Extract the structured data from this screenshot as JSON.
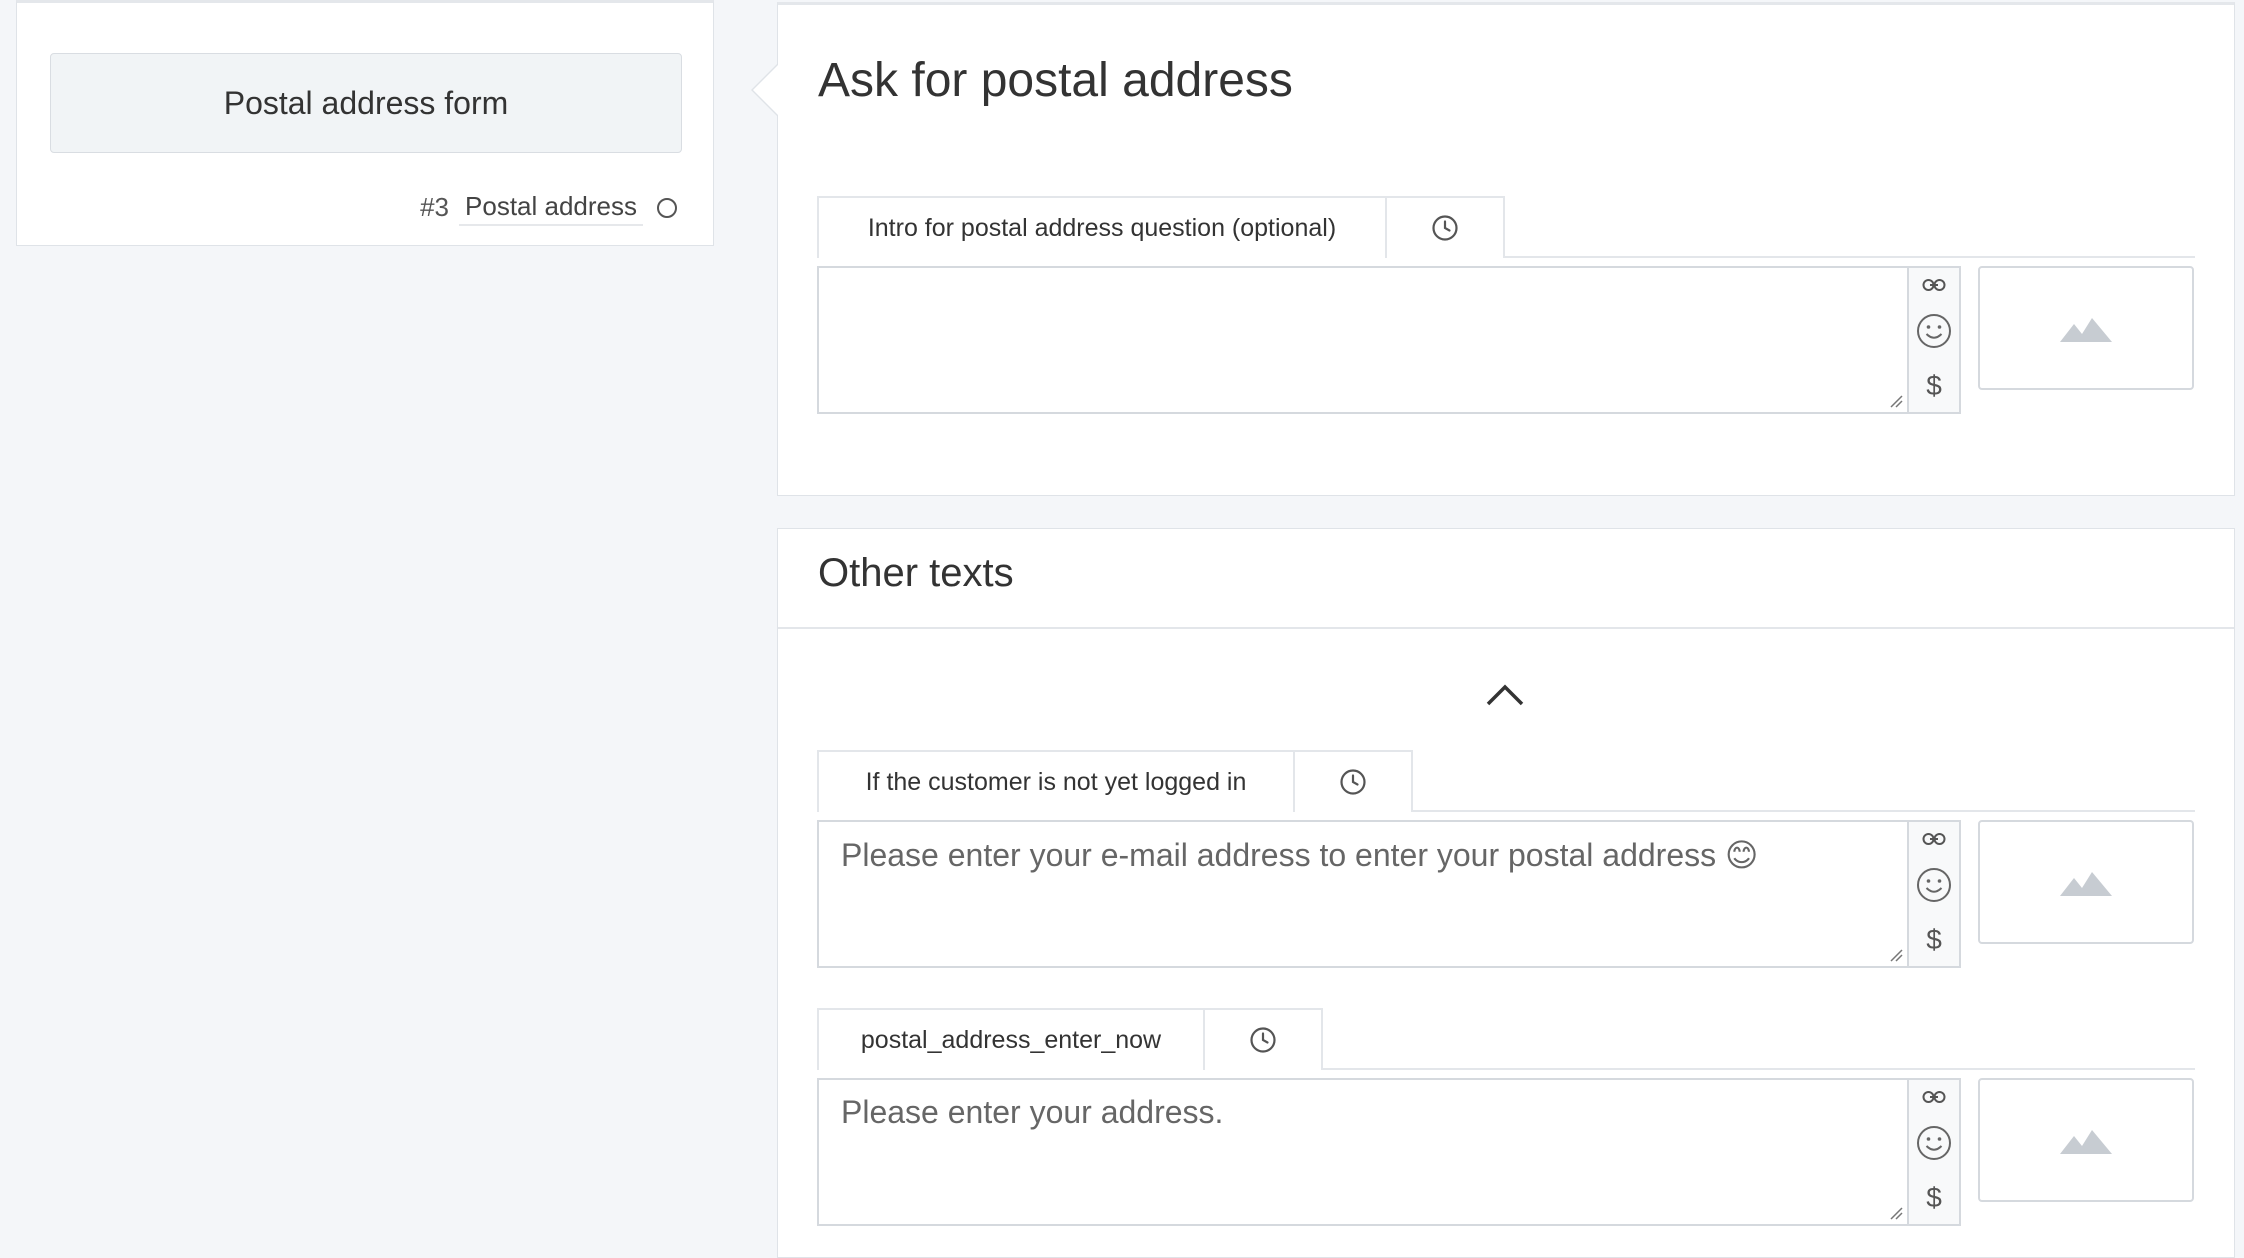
{
  "node": {
    "title": "Postal address form",
    "number": "#3",
    "type": "Postal address"
  },
  "main_panel": {
    "title": "Ask for postal address",
    "fields": [
      {
        "tab_label": "Intro for postal address question (optional)",
        "value": ""
      }
    ]
  },
  "other_texts": {
    "title": "Other texts",
    "fields": [
      {
        "tab_label": "If the customer is not yet logged in",
        "value": "Please enter your e-mail address to enter your postal address 😊"
      },
      {
        "tab_label": "postal_address_enter_now",
        "value": "Please enter your address."
      }
    ]
  },
  "icons": {
    "clock": "clock-icon",
    "link": "link-icon",
    "emoji": "smiley-icon",
    "variable": "dollar-icon",
    "image": "image-placeholder-icon",
    "collapse": "chevron-up-icon"
  },
  "colors": {
    "background": "#f4f6f9",
    "panel": "#ffffff",
    "border": "#dfe3e8",
    "text": "#333333"
  }
}
